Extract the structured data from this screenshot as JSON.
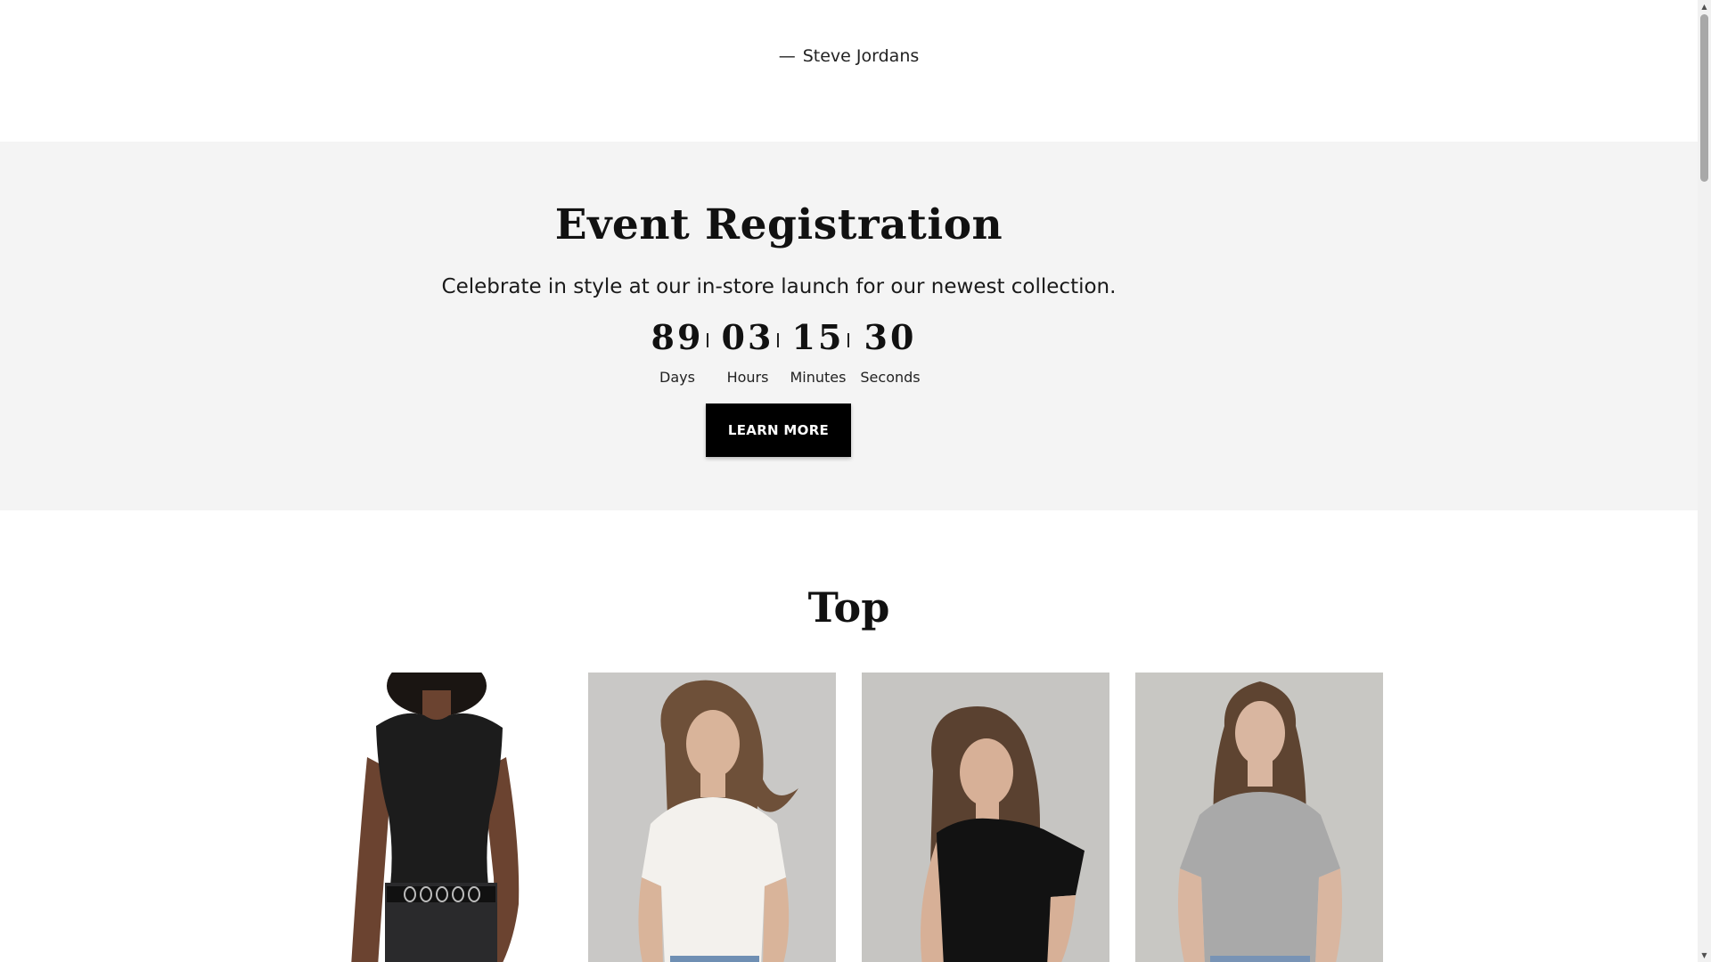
{
  "testimonial": {
    "dash": "—",
    "author": "Steve Jordans"
  },
  "event": {
    "title": "Event Registration",
    "subtitle": "Celebrate in style at our in-store launch for our newest collection.",
    "countdown": [
      {
        "value": "89",
        "label": "Days"
      },
      {
        "value": "03",
        "label": "Hours"
      },
      {
        "value": "15",
        "label": "Minutes"
      },
      {
        "value": "30",
        "label": "Seconds"
      }
    ],
    "button_label": "LEARN MORE"
  },
  "collection": {
    "title": "Top",
    "products": [
      {
        "alt": "Woman in black sleeveless top",
        "top_color": "#1c1c1c",
        "background": "#ffffff"
      },
      {
        "alt": "Woman in white fitted tee",
        "top_color": "#f3f1ed",
        "background": "#c9c8c6"
      },
      {
        "alt": "Woman in black fitted tee",
        "top_color": "#121212",
        "background": "#c6c5c2"
      },
      {
        "alt": "Woman in grey fitted tee",
        "top_color": "#a9a9a9",
        "background": "#c8c7c3"
      }
    ]
  },
  "scrollbar": {
    "up_icon": "arrow-up-icon",
    "down_icon": "arrow-down-icon"
  }
}
